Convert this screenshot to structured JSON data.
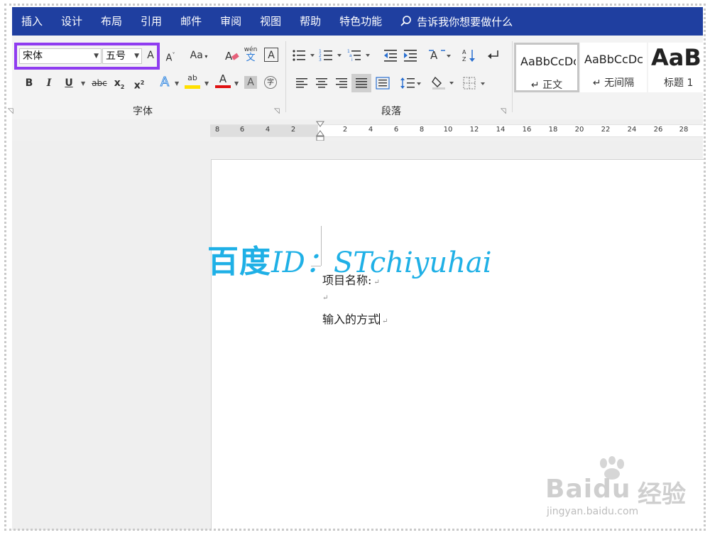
{
  "menu": {
    "items": [
      "插入",
      "设计",
      "布局",
      "引用",
      "邮件",
      "审阅",
      "视图",
      "帮助",
      "特色功能"
    ],
    "tell_me": "告诉我你想要做什么"
  },
  "ribbon": {
    "font_name": "宋体",
    "font_size": "五号",
    "font_group_label": "字体",
    "paragraph_group_label": "段落",
    "buttons": {
      "grow_font": "A",
      "shrink_font": "A",
      "case": "Aa",
      "pinyin_top": "wén",
      "pinyin_bottom": "文",
      "char_border": "A",
      "bold": "B",
      "italic": "I",
      "underline": "U",
      "strike": "abc",
      "subscript_base": "x",
      "subscript_mark": "2",
      "superscript_base": "x",
      "superscript_mark": "2",
      "text_effect": "A",
      "highlight": "ab",
      "font_color": "A",
      "char_shading": "A",
      "enclose": "字"
    },
    "styles": [
      {
        "sample": "AaBbCcDc",
        "name": "↵ 正文"
      },
      {
        "sample": "AaBbCcDc",
        "name": "↵ 无间隔"
      },
      {
        "sample": "AaBl",
        "name": "标题 1"
      }
    ]
  },
  "ruler": {
    "left_ticks": [
      "8",
      "6",
      "4",
      "2"
    ],
    "right_ticks": [
      "2",
      "4",
      "6",
      "8",
      "10",
      "12",
      "14",
      "16",
      "18",
      "20",
      "22",
      "24",
      "26",
      "28"
    ]
  },
  "document": {
    "lines": [
      "项目名称:",
      "",
      "输入的方式"
    ],
    "paragraph_mark": "↵"
  },
  "watermarks": {
    "overlay_cn": "百度",
    "overlay_id": "ID：STchiyuhai",
    "baidu_logo": "Baidu",
    "baidu_jy": "经验",
    "baidu_url": "jingyan.baidu.com"
  },
  "colors": {
    "menu_bg": "#1f3fa0",
    "highlight_box": "#8f3cf0",
    "watermark": "#1fb0e6",
    "font_color_bar": "#e01010",
    "highlight_bar": "#ffe000"
  }
}
